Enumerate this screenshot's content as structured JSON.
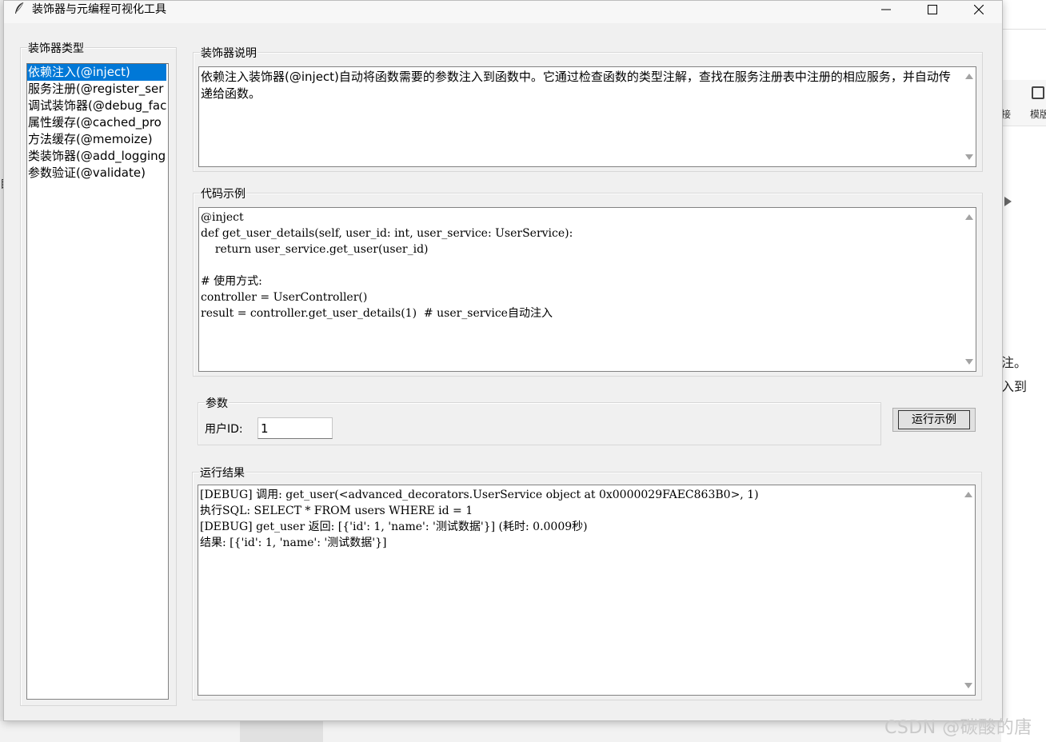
{
  "window": {
    "title": "装饰器与元编程可视化工具"
  },
  "sidebar": {
    "label": "装饰器类型",
    "items": [
      {
        "label": "依赖注入(@inject)",
        "selected": true
      },
      {
        "label": "服务注册(@register_ser",
        "selected": false
      },
      {
        "label": "调试装饰器(@debug_fac",
        "selected": false
      },
      {
        "label": "属性缓存(@cached_pro",
        "selected": false
      },
      {
        "label": "方法缓存(@memoize)",
        "selected": false
      },
      {
        "label": "类装饰器(@add_logging",
        "selected": false
      },
      {
        "label": "参数验证(@validate)",
        "selected": false
      }
    ]
  },
  "description": {
    "label": "装饰器说明",
    "text": "依赖注入装饰器(@inject)自动将函数需要的参数注入到函数中。它通过检查函数的类型注解，查找在服务注册表中注册的相应服务，并自动传递给函数。"
  },
  "code": {
    "label": "代码示例",
    "lines": [
      "@inject",
      "def get_user_details(self, user_id: int, user_service: UserService):",
      "    return user_service.get_user(user_id)",
      "",
      "# 使用方式:",
      "controller = UserController()",
      "result = controller.get_user_details(1)  # user_service自动注入"
    ]
  },
  "params": {
    "label": "参数",
    "user_id_label": "用户ID:",
    "user_id_value": "1"
  },
  "run_button": {
    "label": "运行示例"
  },
  "output": {
    "label": "运行结果",
    "lines": [
      "[DEBUG] 调用: get_user(<advanced_decorators.UserService object at 0x0000029FAEC863B0>, 1)",
      "执行SQL: SELECT * FROM users WHERE id = 1",
      "[DEBUG] get_user 返回: [{'id': 1, 'name': '测试数据'}] (耗时: 0.0009秒)",
      "结果: [{'id': 1, 'name': '测试数据'}]"
    ]
  },
  "background": {
    "watermark": "CSDN @碳酸的唐",
    "right_fragments": [
      "模版",
      "接",
      "注。",
      "入到"
    ],
    "left_fragment": "目"
  },
  "colors": {
    "selection": "#0078d7",
    "window_bg": "#f0f0f0"
  }
}
